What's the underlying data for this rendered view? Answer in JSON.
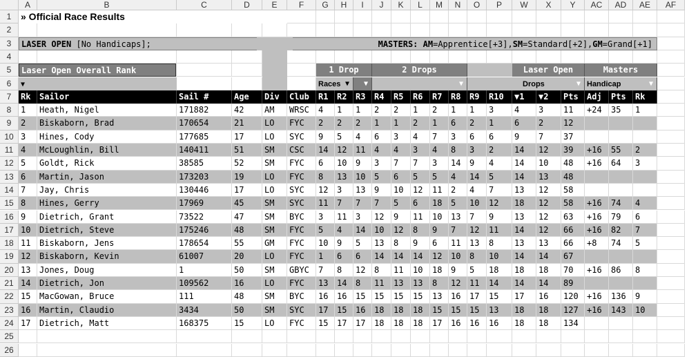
{
  "columns": [
    "A",
    "B",
    "C",
    "D",
    "E",
    "F",
    "G",
    "H",
    "I",
    "J",
    "K",
    "L",
    "M",
    "N",
    "O",
    "P",
    "W",
    "X",
    "Y",
    "AC",
    "AD",
    "AE",
    "AF"
  ],
  "title": "» Official Race Results",
  "row3": {
    "left_bold": "LASER OPEN",
    "left_rest": " [No Handicaps];",
    "right_bold": "MASTERS: AM",
    "right_rest": "=Apprentice[+3],SM=Standard[+2],GM=Grand[+1]"
  },
  "row3_parts": [
    "AM",
    "=Apprentice[+3],",
    "SM",
    "=Standard[+2],",
    "GM",
    "=Grand[+1]"
  ],
  "overall_rank": "Laser Open Overall Rank",
  "group_headers": {
    "one_drop": "1 Drop",
    "two_drops": "2 Drops",
    "laser_open": "Laser Open",
    "masters": "Masters"
  },
  "sub_headers": {
    "races": "Races",
    "drops": "Drops",
    "handicap": "Handicap"
  },
  "filter_arrow": "▼",
  "header_row": [
    "Rk",
    "Sailor",
    "Sail #",
    "Age",
    "Div",
    "Club",
    "R1",
    "R2",
    "R3",
    "R4",
    "R5",
    "R6",
    "R7",
    "R8",
    "R9",
    "R10",
    "▼1",
    "▼2",
    "Pts",
    "Adj",
    "Pts",
    "Rk"
  ],
  "rows": [
    [
      "1",
      "Heath, Nigel",
      "171882",
      "42",
      "AM",
      "WRSC",
      "4",
      "1",
      "1",
      "2",
      "2",
      "1",
      "2",
      "1",
      "1",
      "3",
      "4",
      "3",
      "11",
      "+24",
      "35",
      "1"
    ],
    [
      "2",
      "Biskaborn, Brad",
      "170654",
      "21",
      "LO",
      "FYC",
      "2",
      "2",
      "2",
      "1",
      "1",
      "2",
      "1",
      "6",
      "2",
      "1",
      "6",
      "2",
      "12",
      "",
      "",
      ""
    ],
    [
      "3",
      "Hines, Cody",
      "177685",
      "17",
      "LO",
      "SYC",
      "9",
      "5",
      "4",
      "6",
      "3",
      "4",
      "7",
      "3",
      "6",
      "6",
      "9",
      "7",
      "37",
      "",
      "",
      ""
    ],
    [
      "4",
      "McLoughlin, Bill",
      "140411",
      "51",
      "SM",
      "CSC",
      "14",
      "12",
      "11",
      "4",
      "4",
      "3",
      "4",
      "8",
      "3",
      "2",
      "14",
      "12",
      "39",
      "+16",
      "55",
      "2"
    ],
    [
      "5",
      "Goldt, Rick",
      "38585",
      "52",
      "SM",
      "FYC",
      "6",
      "10",
      "9",
      "3",
      "7",
      "7",
      "3",
      "14",
      "9",
      "4",
      "14",
      "10",
      "48",
      "+16",
      "64",
      "3"
    ],
    [
      "6",
      "Martin, Jason",
      "173203",
      "19",
      "LO",
      "FYC",
      "8",
      "13",
      "10",
      "5",
      "6",
      "5",
      "5",
      "4",
      "14",
      "5",
      "14",
      "13",
      "48",
      "",
      "",
      ""
    ],
    [
      "7",
      "Jay, Chris",
      "130446",
      "17",
      "LO",
      "SYC",
      "12",
      "3",
      "13",
      "9",
      "10",
      "12",
      "11",
      "2",
      "4",
      "7",
      "13",
      "12",
      "58",
      "",
      "",
      ""
    ],
    [
      "8",
      "Hines, Gerry",
      "17969",
      "45",
      "SM",
      "SYC",
      "11",
      "7",
      "7",
      "7",
      "5",
      "6",
      "18",
      "5",
      "10",
      "12",
      "18",
      "12",
      "58",
      "+16",
      "74",
      "4"
    ],
    [
      "9",
      "Dietrich, Grant",
      "73522",
      "47",
      "SM",
      "BYC",
      "3",
      "11",
      "3",
      "12",
      "9",
      "11",
      "10",
      "13",
      "7",
      "9",
      "13",
      "12",
      "63",
      "+16",
      "79",
      "6"
    ],
    [
      "10",
      "Dietrich, Steve",
      "175246",
      "48",
      "SM",
      "FYC",
      "5",
      "4",
      "14",
      "10",
      "12",
      "8",
      "9",
      "7",
      "12",
      "11",
      "14",
      "12",
      "66",
      "+16",
      "82",
      "7"
    ],
    [
      "11",
      "Biskaborn, Jens",
      "178654",
      "55",
      "GM",
      "FYC",
      "10",
      "9",
      "5",
      "13",
      "8",
      "9",
      "6",
      "11",
      "13",
      "8",
      "13",
      "13",
      "66",
      "+8",
      "74",
      "5"
    ],
    [
      "12",
      "Biskaborn, Kevin",
      "61007",
      "20",
      "LO",
      "FYC",
      "1",
      "6",
      "6",
      "14",
      "14",
      "14",
      "12",
      "10",
      "8",
      "10",
      "14",
      "14",
      "67",
      "",
      "",
      ""
    ],
    [
      "13",
      "Jones, Doug",
      "1",
      "50",
      "SM",
      "GBYC",
      "7",
      "8",
      "12",
      "8",
      "11",
      "10",
      "18",
      "9",
      "5",
      "18",
      "18",
      "18",
      "70",
      "+16",
      "86",
      "8"
    ],
    [
      "14",
      "Dietrich, Jon",
      "109562",
      "16",
      "LO",
      "FYC",
      "13",
      "14",
      "8",
      "11",
      "13",
      "13",
      "8",
      "12",
      "11",
      "14",
      "14",
      "14",
      "89",
      "",
      "",
      ""
    ],
    [
      "15",
      "MacGowan, Bruce",
      "111",
      "48",
      "SM",
      "BYC",
      "16",
      "16",
      "15",
      "15",
      "15",
      "15",
      "13",
      "16",
      "17",
      "15",
      "17",
      "16",
      "120",
      "+16",
      "136",
      "9"
    ],
    [
      "16",
      "Martin, Claudio",
      "3434",
      "50",
      "SM",
      "SYC",
      "17",
      "15",
      "16",
      "18",
      "18",
      "18",
      "15",
      "15",
      "15",
      "13",
      "18",
      "18",
      "127",
      "+16",
      "143",
      "10"
    ],
    [
      "17",
      "Dietrich, Matt",
      "168375",
      "15",
      "LO",
      "FYC",
      "15",
      "17",
      "17",
      "18",
      "18",
      "18",
      "17",
      "16",
      "16",
      "16",
      "18",
      "18",
      "134",
      "",
      "",
      ""
    ]
  ]
}
